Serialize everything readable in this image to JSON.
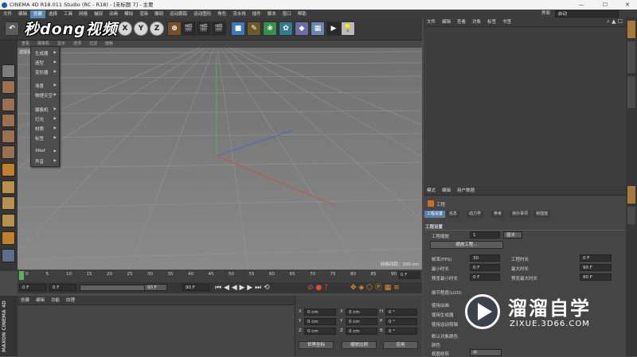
{
  "window": {
    "title": "CINEMA 4D R18.011 Studio (RC - R18) - [未标题 7] - 主要"
  },
  "menubar": [
    "文件",
    "编辑",
    "创建",
    "选择",
    "工具",
    "网格",
    "捕捉",
    "动画",
    "模拟",
    "渲染",
    "雕刻",
    "运动跟踪",
    "运动图形",
    "角色",
    "流水线",
    "插件",
    "脚本",
    "窗口",
    "帮助"
  ],
  "menubar_right": {
    "label": "界面",
    "value": "启动"
  },
  "watermark_top": "秒dong视频",
  "toolbar_axes": [
    "X",
    "Y",
    "Z"
  ],
  "viewport": {
    "menu": [
      "查看",
      "摄像机",
      "显示",
      "选项",
      "过滤",
      "面板"
    ],
    "label": "透视视图",
    "grid_info": "网格间距：100 cm",
    "create_menu": [
      "生成器",
      "造型",
      "变形器",
      "场景",
      "物理天空",
      "摄像机",
      "灯光",
      "材质",
      "标签",
      "XRef",
      "声音"
    ]
  },
  "timeline": {
    "ticks": [
      "0",
      "5",
      "10",
      "15",
      "20",
      "25",
      "30",
      "35",
      "40",
      "45",
      "50",
      "55",
      "60",
      "65",
      "70",
      "75",
      "80",
      "85",
      "90"
    ],
    "end": "0 F",
    "start_field": "0 F",
    "current_field": "0 F",
    "range_end": "90 F",
    "range_end2": "90 F"
  },
  "material_panel": {
    "menu": [
      "创建",
      "编辑",
      "功能",
      "纹理"
    ]
  },
  "coords": {
    "rows": [
      {
        "a": "X",
        "av": "0 cm",
        "b": "X",
        "bv": "0 cm",
        "c": "H",
        "cv": "0 °"
      },
      {
        "a": "Y",
        "av": "0 cm",
        "b": "Y",
        "bv": "0 cm",
        "c": "P",
        "cv": "0 °"
      },
      {
        "a": "Z",
        "av": "0 cm",
        "b": "Z",
        "bv": "0 cm",
        "c": "B",
        "cv": "0 °"
      }
    ],
    "world": "世界坐标",
    "scale": "缩放比例",
    "apply": "应用"
  },
  "object_panel": {
    "menu": [
      "文件",
      "编辑",
      "查看",
      "对象",
      "标签",
      "书签"
    ]
  },
  "attr_panel": {
    "menu": [
      "模式",
      "编辑",
      "用户数据"
    ],
    "title": "工程",
    "tabs": [
      "工程设置",
      "信息",
      "动力学",
      "参考",
      "待办事项",
      "帧插值"
    ],
    "section": "工程设置",
    "scale_label": "工程缩放",
    "scale_value": "1",
    "scale_unit": "厘米",
    "scale_button": "缩放工程...",
    "fps_label": "帧率(FPS)",
    "fps_value": "30",
    "project_time_label": "工程时长",
    "project_time_value": "0 F",
    "min_time_label": "最小时长",
    "min_time_value": "0 F",
    "max_time_label": "最大时长",
    "max_time_value": "90 F",
    "preview_min_label": "预览最小时长",
    "preview_min_value": "0 F",
    "preview_max_label": "预览最大时长",
    "preview_max_value": "90 F",
    "lod_label": "细节程度(LOD)",
    "use_anim": "使用动画",
    "use_gen": "使用生成器",
    "use_motion": "使用运动剪辑",
    "default_obj_color": "默认对象颜色",
    "color": "颜色",
    "clipping_label": "视图修剪",
    "clipping_value": "中"
  },
  "watermark": {
    "brand": "溜溜自学",
    "url": "ZIXUE.3D66.COM"
  }
}
